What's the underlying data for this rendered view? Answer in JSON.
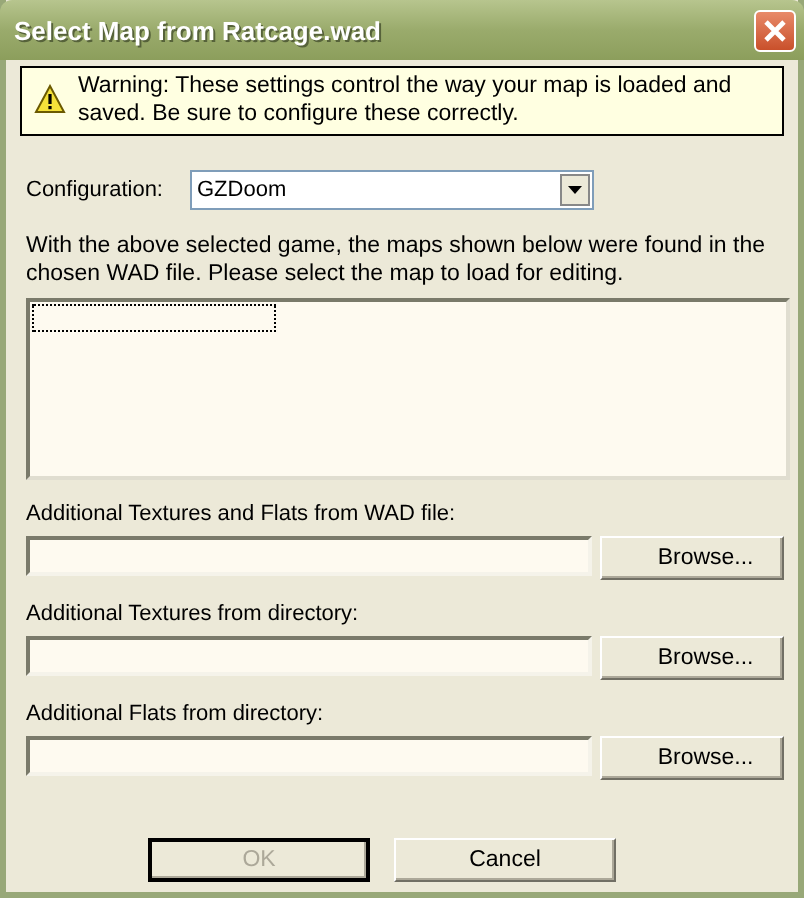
{
  "window": {
    "title": "Select Map from Ratcage.wad"
  },
  "warning": {
    "text": "Warning: These settings control the way your map is loaded and saved. Be sure to configure these correctly."
  },
  "configuration": {
    "label": "Configuration:",
    "value": "GZDoom"
  },
  "instructions": "With the above selected game, the maps shown below were found in the chosen WAD file. Please select the map to load for editing.",
  "resource_fields": [
    {
      "label": "Additional Textures and Flats from WAD file:",
      "button": "Browse..."
    },
    {
      "label": "Additional Textures from directory:",
      "button": "Browse..."
    },
    {
      "label": "Additional Flats from directory:",
      "button": "Browse..."
    }
  ],
  "buttons": [
    {
      "label": "OK",
      "disabled": true
    },
    {
      "label": "Cancel",
      "disabled": false
    }
  ]
}
